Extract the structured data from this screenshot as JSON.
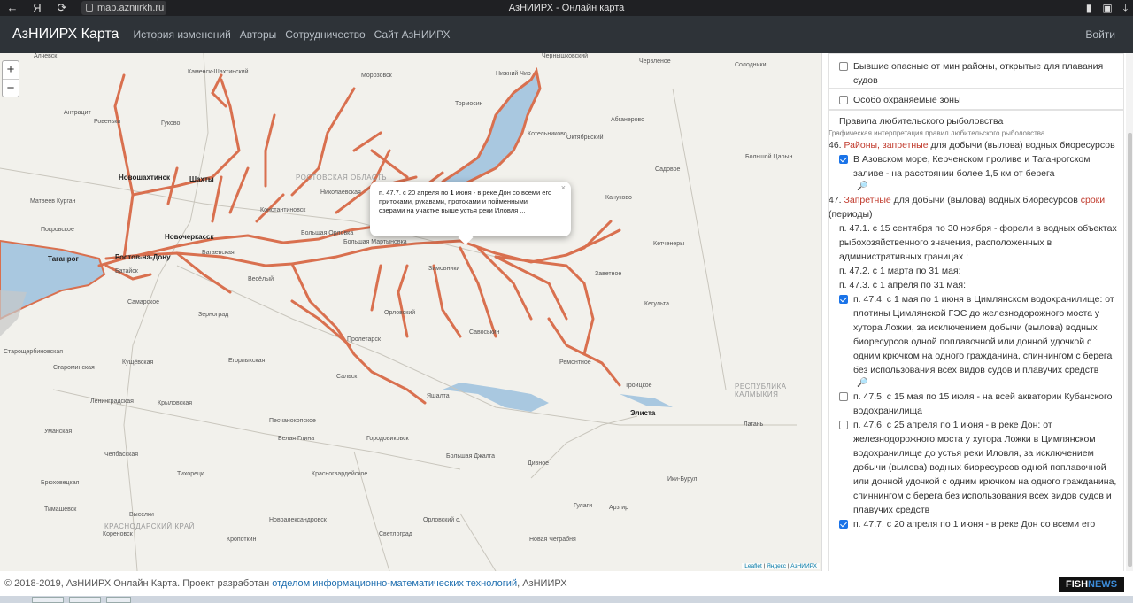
{
  "browser": {
    "back_icon": "←",
    "yandex_icon": "Я",
    "reload_icon": "⟳",
    "url": "map.azniirkh.ru",
    "tab_title": "АзНИИРХ - Онлайн карта",
    "bookmark_icon": "bookmark-icon",
    "extensions_icon": "extensions-icon",
    "download_icon": "download-icon"
  },
  "navbar": {
    "brand": "АзНИИРХ Карта",
    "links": [
      "История изменений",
      "Авторы",
      "Сотрудничество",
      "Сайт АзНИИРХ"
    ],
    "login": "Войти"
  },
  "map": {
    "zoom_in": "+",
    "zoom_out": "−",
    "popup_text_a": "п. 47.7. с 20 апреля по ",
    "popup_bold": "1",
    "popup_text_b": " июня - в реке Дон со всеми его притоками, рукавами, протоками и пойменными озерами на участке выше устья реки Иловля ...",
    "popup_close": "×",
    "attribution_leaflet": "Leaflet",
    "attribution_sep": " | ",
    "attribution_yandex": "Яндекс",
    "attribution_sep2": " | ",
    "attribution_azniirkh": "АзНИИРХ",
    "labels": {
      "l1": "Алчевск",
      "l2": "Каменск-Шахтинский",
      "l3": "Морозовск",
      "l4": "Нижний Чир",
      "l5": "Чернышковский",
      "l6": "Червленое",
      "l7": "Солодники",
      "l8": "Антрацит",
      "l9": "Ровеньки",
      "l10": "Гуково",
      "l11": "Тормосин",
      "l12": "Абганерово",
      "l13": "Октябрьский",
      "l14": "Котельниково",
      "l15": "Садовое",
      "l16": "Большой Царын",
      "l17": "Новошахтинск",
      "l18": "Шахты",
      "l19": "Матвеев Курган",
      "l20": "Покровское",
      "l21": "Новочеркасск",
      "l22": "Таганрог",
      "l23": "Ростов-на-Дону",
      "l24": "Батайск",
      "l25": "Багаевская",
      "l26": "Константиновск",
      "l27": "Николаевская",
      "l28": "Большая Орловка",
      "l29": "Большая Мартыновка",
      "l30": "Зимовники",
      "l31": "Заветное",
      "l32": "Кануково",
      "l33": "Кетченеры",
      "l34": "Самарское",
      "l35": "Зерноград",
      "l36": "Орловский",
      "l37": "Савоськин",
      "l38": "Кегульта",
      "l39": "Старощербиновская",
      "l40": "Староминская",
      "l41": "Кущёвская",
      "l42": "Егорлыкская",
      "l43": "Сальск",
      "l44": "Пролетарск",
      "l45": "Ремонтное",
      "l46": "Троицкое",
      "l47": "Элиста",
      "l48": "РЕСПУБЛИКА КАЛМЫКИЯ",
      "l49": "Ленинградская",
      "l50": "Крыловская",
      "l51": "Песчанокопское",
      "l52": "Яшалта",
      "l53": "Белая Глина",
      "l54": "Городовиковск",
      "l55": "Уманская",
      "l56": "Челбасская",
      "l57": "Тихорецк",
      "l58": "Красногвардейское",
      "l59": "Дивное",
      "l60": "Брюховецкая",
      "l61": "Выселки",
      "l62": "Тимашевск",
      "l63": "Кореновск",
      "l64": "КРАСНОДАРСКИЙ КРАЙ",
      "l65": "Кропоткин",
      "l66": "Новоалександровск",
      "l67": "Светлоград",
      "l68": "Большая Джалга",
      "l69": "Арзгир",
      "l70": "Ики-Бурул",
      "l71": "Лагань",
      "l72": "Гулаги",
      "l73": "Новая Чеграбня",
      "l74": "Орловский с.",
      "l75": "Весёлый",
      "l76": "РОСТОВСКАЯ ОБЛАСТЬ"
    }
  },
  "panel": {
    "layer1": "Бывшие опасные от мин районы, открытые для плавания судов",
    "layer2": "Особо охраняемые зоны",
    "rules_title": "Правила любительского рыболовства",
    "rules_sub": "Графическая интерпретация правил любительского рыболовства",
    "p46_num": "46. ",
    "p46_red": "Районы, запретные",
    "p46_rest": " для добычи (вылова) водных биоресурсов",
    "p46_item": "В Азовском море, Керченском проливе и Таганрогском заливе - на расстоянии более 1,5 км от берега",
    "p47_num": "47. ",
    "p47_red": "Запретные",
    "p47_mid": " для добычи (вылова) водных биоресурсов ",
    "p47_red2": "сроки",
    "p47_end": " (периоды)",
    "p471": "п. 47.1. с 15 сентября по 30 ноября - форели в водных объектах рыбохозяйственного значения, расположенных в административных границах :",
    "p472": "п. 47.2. с 1 марта по 31 мая:",
    "p473": "п. 47.3. с 1 апреля по 31 мая:",
    "p474": "п. 47.4. с 1 мая по 1 июня в Цимлянском водохранилище: от плотины Цимлянской ГЭС до железнодорожного моста у хутора Ложки, за исключением добычи (вылова) водных биоресурсов одной поплавочной или донной удочкой с одним крючком на одного гражданина, спиннингом с берега без использования всех видов судов и плавучих средств",
    "p475": "п. 47.5. с 15 мая по 15 июля - на всей акватории Кубанского водохранилища",
    "p476": "п. 47.6. с 25 апреля по 1 июня - в реке Дон: от железнодорожного моста у хутора Ложки в Цимлянском водохранилище до устья реки Иловля, за исключением добычи (вылова) водных биоресурсов одной поплавочной или донной удочкой с одним крючком на одного гражданина, спиннингом с берега без использования всех видов судов и плавучих средств",
    "p477": "п. 47.7. с 20 апреля по 1 июня - в реке Дон со всеми его",
    "mag1": "🔎",
    "mag2": "🔎"
  },
  "footer": {
    "text_a": "© 2018-2019, АзНИИРХ Онлайн Карта. Проект разработан ",
    "link": "отделом информационно-математических технологий",
    "text_b": ", АзНИИРХ",
    "badge_a": "FISH",
    "badge_b": "NEWS"
  },
  "colors": {
    "river": "#d9704f",
    "water": "#a9c8e0",
    "accent": "#c0392b",
    "nav": "#2e3338"
  }
}
